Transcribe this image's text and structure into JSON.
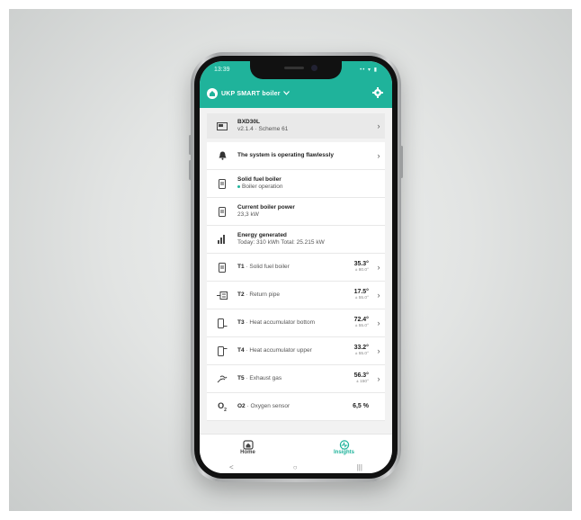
{
  "status_bar": {
    "time": "13:39",
    "icons": "•• ▾ ▮"
  },
  "header": {
    "title": "UKP SMART boiler",
    "dropdown_icon": "chevron-down-icon",
    "settings_icon": "gear-icon",
    "brand_color": "#1fb39b"
  },
  "device": {
    "name": "BXD30L",
    "version": "v2.1.4 · Scheme 61"
  },
  "rows": [
    {
      "title": "The system is operating flawlessly",
      "icon": "bell-icon",
      "arrow": true
    },
    {
      "title": "Solid fuel boiler",
      "sub": "Boiler operation",
      "icon": "boiler-icon"
    },
    {
      "title": "Current boiler power",
      "sub": "23,3 kW",
      "icon": "boiler-icon"
    },
    {
      "title": "Energy generated",
      "sub": "Today: 310 kWh Total: 25.215 kW",
      "icon": "bar-chart-icon"
    }
  ],
  "sensors": [
    {
      "code": "T1",
      "label": " · Solid fuel boiler",
      "value": "35.3°",
      "set": "± 80.0°",
      "icon": "boiler-icon"
    },
    {
      "code": "T2",
      "label": " · Return pipe",
      "value": "17.5°",
      "set": "± 55.0°",
      "icon": "return-pipe-icon"
    },
    {
      "code": "T3",
      "label": " · Heat accumulator bottom",
      "value": "72.4°",
      "set": "± 55.0°",
      "icon": "accumulator-bottom-icon"
    },
    {
      "code": "T4",
      "label": " · Heat accumulator upper",
      "value": "33.2°",
      "set": "± 55.0°",
      "icon": "accumulator-upper-icon"
    },
    {
      "code": "T5",
      "label": " · Exhaust gas",
      "value": "56.3°",
      "set": "± 150°",
      "icon": "exhaust-gas-icon"
    }
  ],
  "oxygen": {
    "symbol": "O",
    "symbol_sub": "2",
    "code": "O2",
    "label": " · Oxygen sensor",
    "value": "6,5 %"
  },
  "tabs": {
    "home": "Home",
    "insights": "Insights"
  },
  "navbar": {
    "back": "<",
    "home": "○",
    "recents": "|||"
  }
}
